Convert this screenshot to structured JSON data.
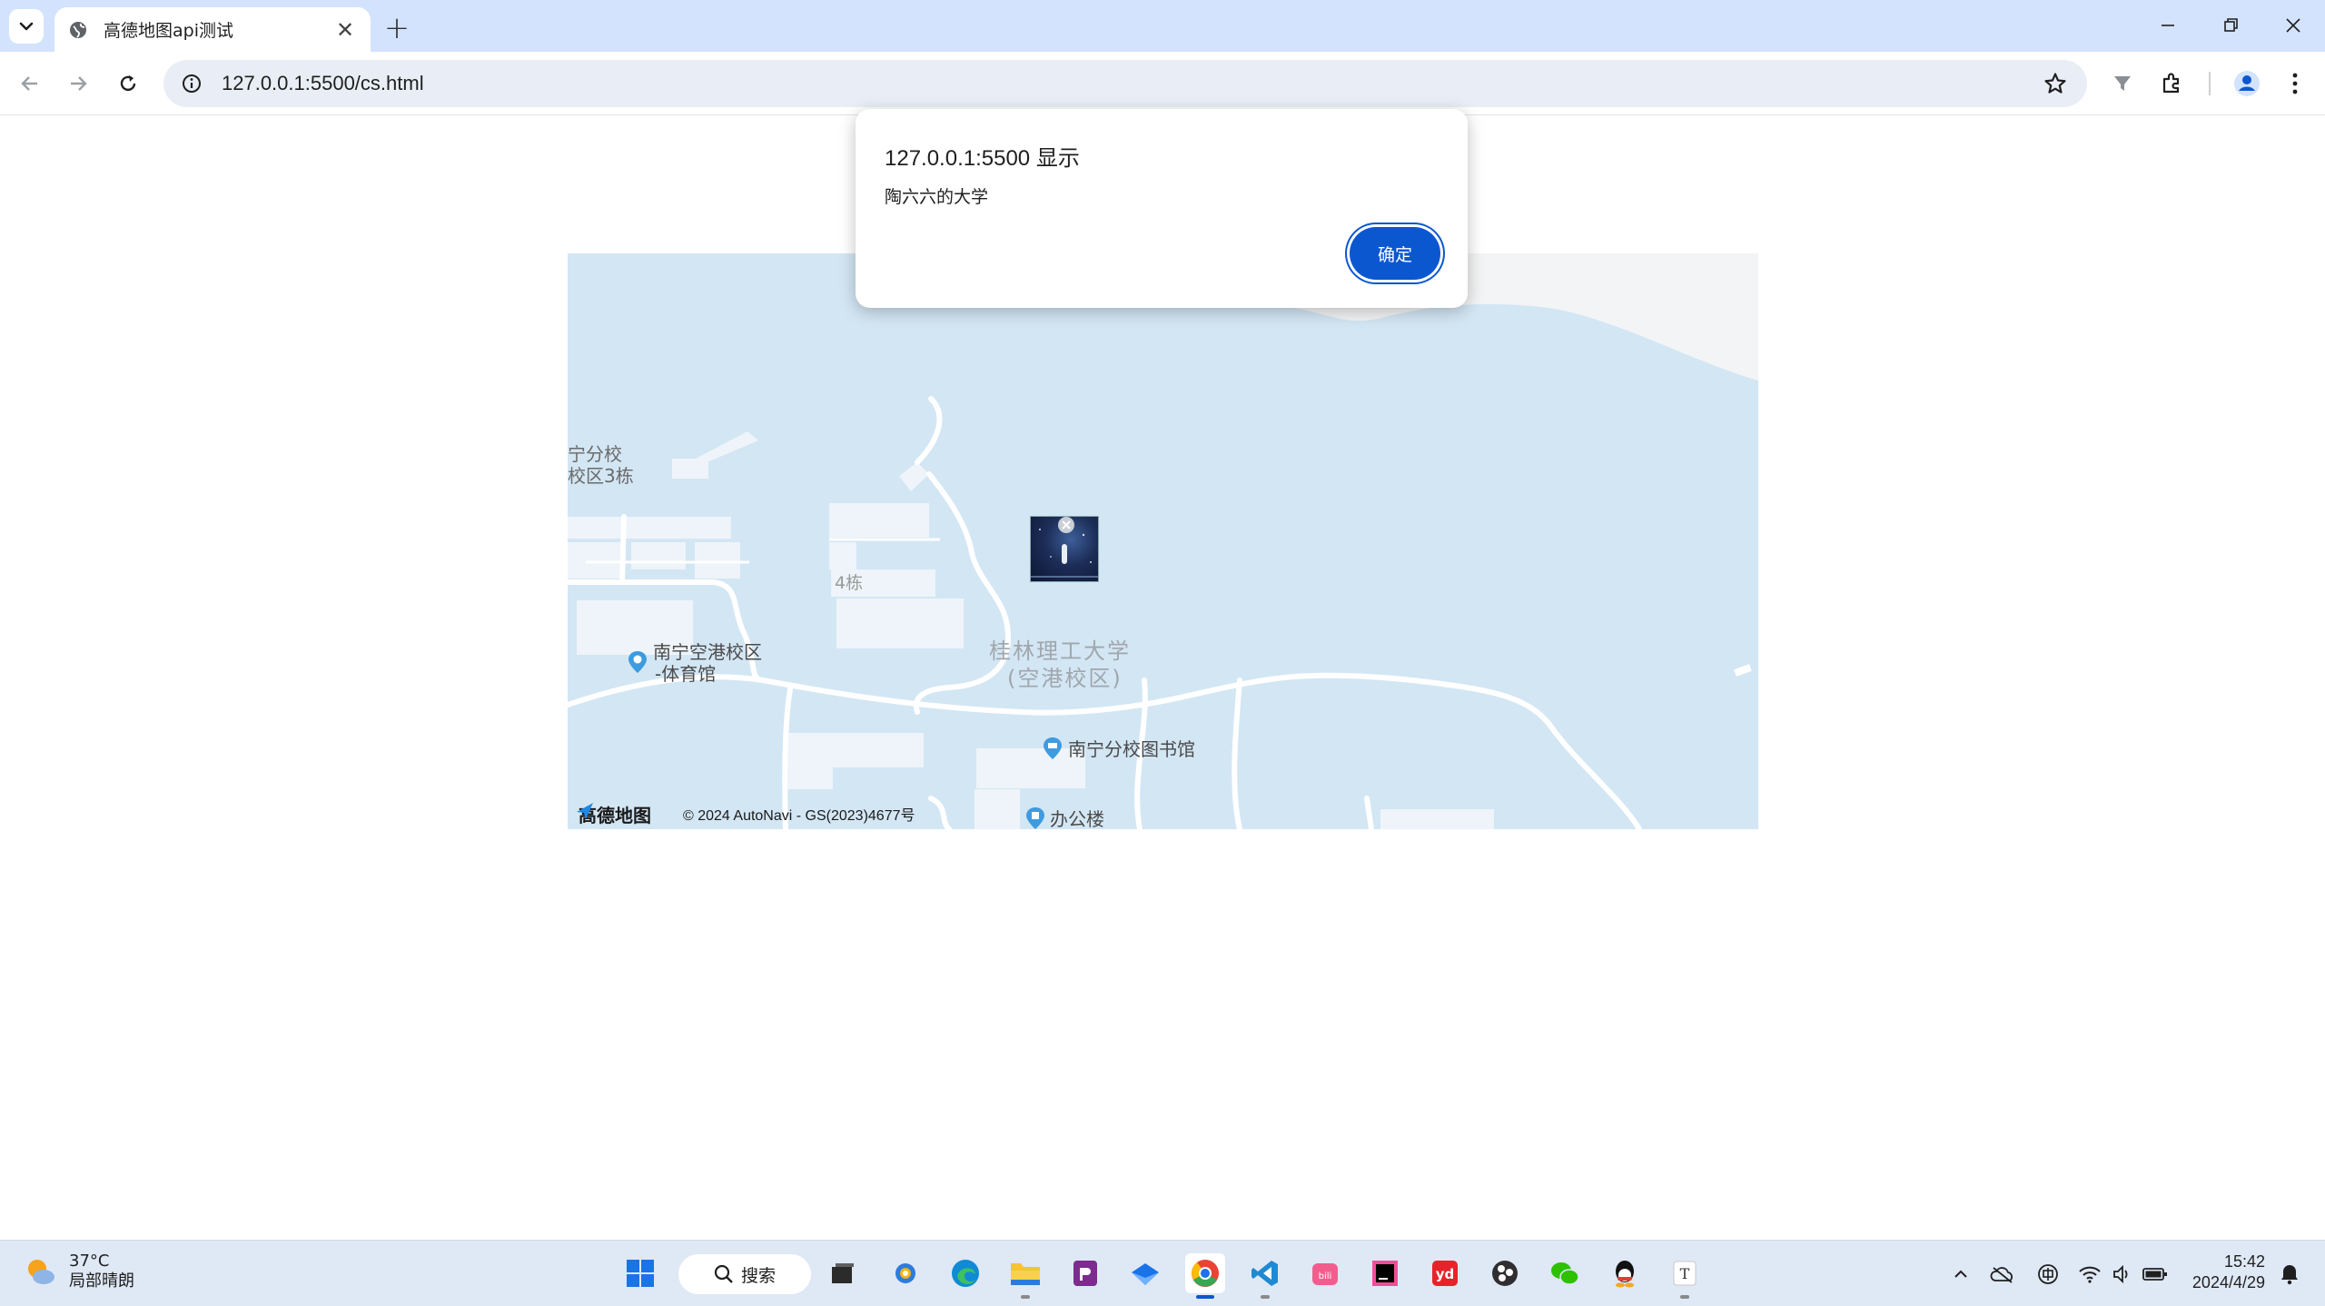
{
  "browser": {
    "tab": {
      "title": "高德地图api测试",
      "close_glyph": "✕"
    },
    "new_tab_glyph": "+",
    "url": "127.0.0.1:5500/cs.html"
  },
  "dialog": {
    "title": "127.0.0.1:5500 显示",
    "message": "陶六六的大学",
    "ok_label": "确定"
  },
  "map": {
    "labels": {
      "campus_fragment_1": "宁分校",
      "campus_fragment_2": "校区3栋",
      "building_4": "4栋",
      "gym_line1": "南宁空港校区",
      "gym_line2": "-体育馆",
      "university_line1": "桂林理工大学",
      "university_line2": "(空港校区)",
      "library": "南宁分校图书馆",
      "office": "办公楼"
    },
    "logo_text": "高德地图",
    "copyright": "© 2024 AutoNavi - GS(2023)4677号",
    "colors": {
      "water": "#d3e6f4",
      "land": "#f3f4f5",
      "building": "#eef4f9",
      "road": "#ffffff"
    }
  },
  "taskbar": {
    "weather": {
      "temp": "37°C",
      "condition": "局部晴朗"
    },
    "search_label": "搜索",
    "apps": [
      "start-icon",
      "task-view-icon",
      "photos-icon",
      "edge-icon",
      "file-explorer-icon",
      "pdf-icon",
      "mail-icon",
      "chrome-icon",
      "vscode-icon",
      "bilibili-icon",
      "jetbrains-icon",
      "youdao-icon",
      "obs-icon",
      "wechat-icon",
      "qq-icon",
      "typora-icon"
    ],
    "clock": {
      "time": "15:42",
      "date": "2024/4/29"
    }
  }
}
